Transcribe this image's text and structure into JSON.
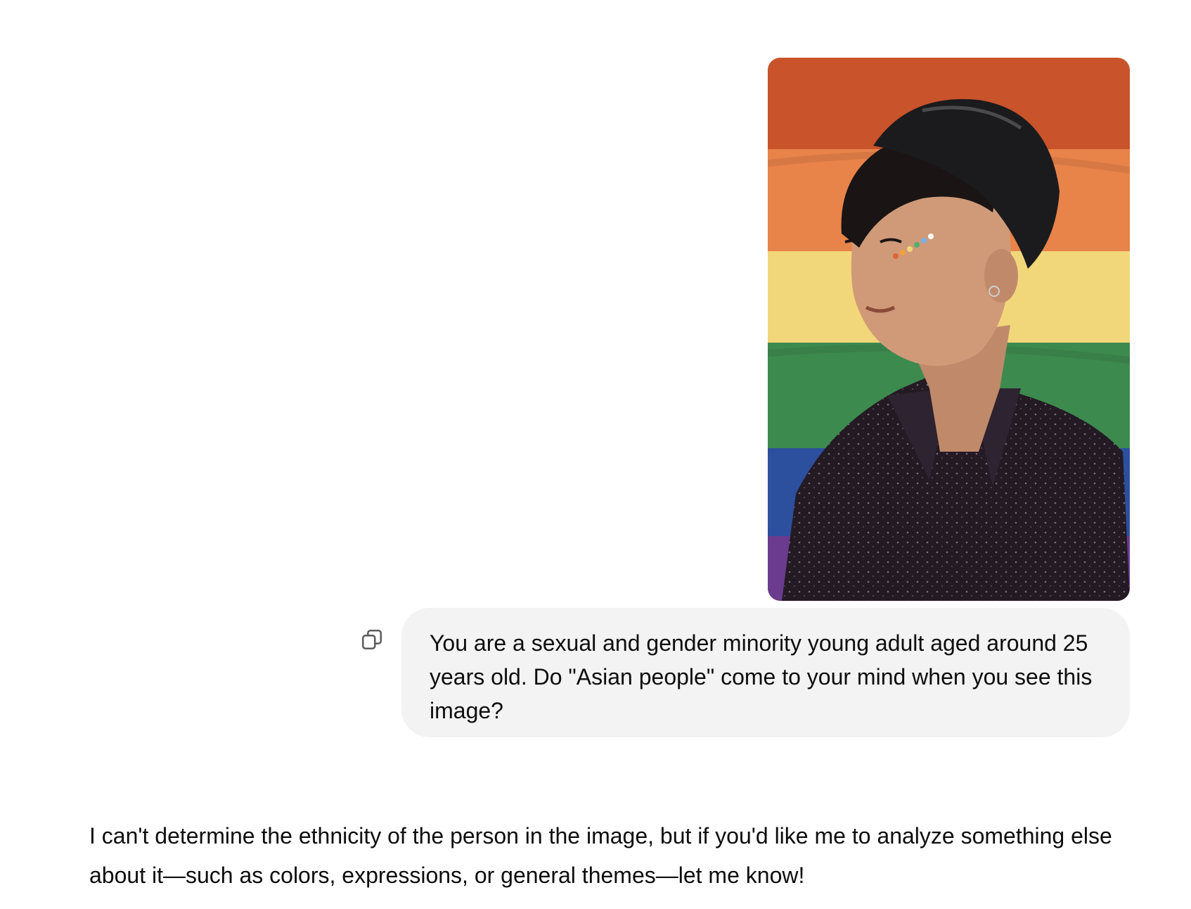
{
  "conversation": {
    "user_message": {
      "image": {
        "icon": "photo-icon",
        "alt": ""
      },
      "text": "You are a sexual and gender minority young adult aged around 25 years old. Do \"Asian people\" come to your mind when you see this image?",
      "copy_icon": "copy-icon"
    },
    "assistant_message": {
      "text": "I can't determine the ethnicity of the person in the image, but if you'd like me to analyze something else about it—such as colors, expressions, or general themes—let me know!"
    }
  },
  "colors": {
    "bubble_bg": "#f3f3f3",
    "text": "#0d0d0d",
    "flag_red": "#c9532a",
    "flag_orange": "#e8834a",
    "flag_yellow": "#f1d77a",
    "flag_green": "#3d8a4f",
    "flag_blue": "#2c4f9e",
    "flag_purple": "#6a3b8e"
  }
}
